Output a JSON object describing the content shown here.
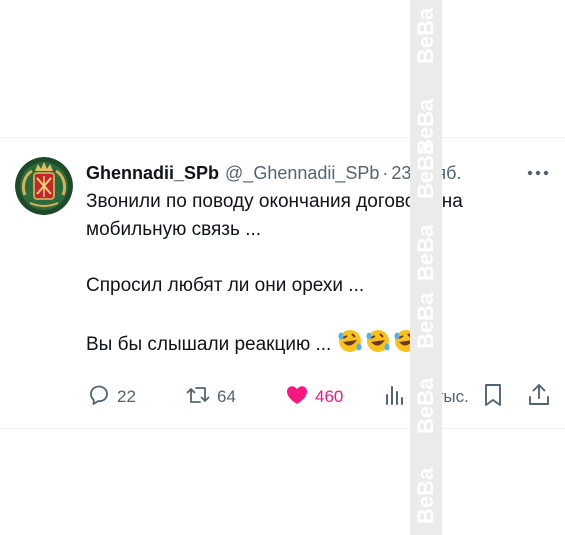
{
  "tweet": {
    "display_name": "Ghennadii_SPb",
    "handle": "@_Ghennadii_SPb",
    "separator": "·",
    "time": "23 нояб.",
    "paragraphs": [
      "Звонили по поводу окончания договора на мобильную связь ...",
      "Спросил любят ли они орехи ...",
      "Вы бы слышали реакцию ..."
    ],
    "emoji": "rolling-on-floor-laughing x3"
  },
  "actions": {
    "replies": "22",
    "reposts": "64",
    "likes": "460",
    "views": "16 тыс."
  },
  "colors": {
    "text": "#0f1419",
    "secondary": "#536471",
    "like": "#f91880",
    "divider": "#eff3f4",
    "watermark_bg": "#ebebeb"
  },
  "icons": [
    "more-icon",
    "reply-icon",
    "repost-icon",
    "like-icon",
    "views-icon",
    "bookmark-icon",
    "share-icon"
  ],
  "watermark": {
    "text": "BeBa"
  }
}
